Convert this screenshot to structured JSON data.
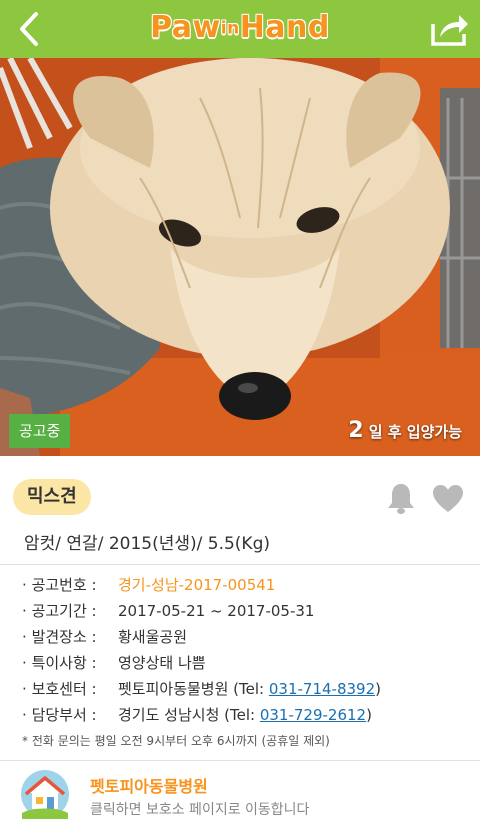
{
  "header": {
    "logo_main_1": "Paw",
    "logo_small": "in",
    "logo_main_2": "Hand",
    "colors": {
      "bar": "#8dc63f",
      "logo": "#f7941d"
    }
  },
  "photo": {
    "status_badge": "공고중",
    "adopt_days": "2",
    "adopt_suffix": "일 후 입양가능"
  },
  "animal": {
    "breed": "믹스견",
    "summary": "암컷/ 연갈/ 2015(년생)/ 5.5(Kg)"
  },
  "details": {
    "notice_no_label": "공고번호 :",
    "notice_no": "경기-성남-2017-00541",
    "period_label": "공고기간 :",
    "period": "2017-05-21 ~ 2017-05-31",
    "found_label": "발견장소 :",
    "found": "황새울공원",
    "special_label": "특이사항 :",
    "special": "영양상태 나쁨",
    "center_label": "보호센터 :",
    "center_name": "펫토피아동물병원 (Tel: ",
    "center_tel": "031-714-8392",
    "center_close": ")",
    "office_label": "담당부서 :",
    "office_name": "경기도 성남시청 (Tel: ",
    "office_tel": "031-729-2612",
    "office_close": ")",
    "bullet": "·",
    "note": "* 전화 문의는 평일 오전 9시부터 오후 6시까지 (공휴일 제외)"
  },
  "hospital": {
    "name": "펫토피아동물병원",
    "subtitle": "클릭하면 보호소 페이지로 이동합니다"
  }
}
